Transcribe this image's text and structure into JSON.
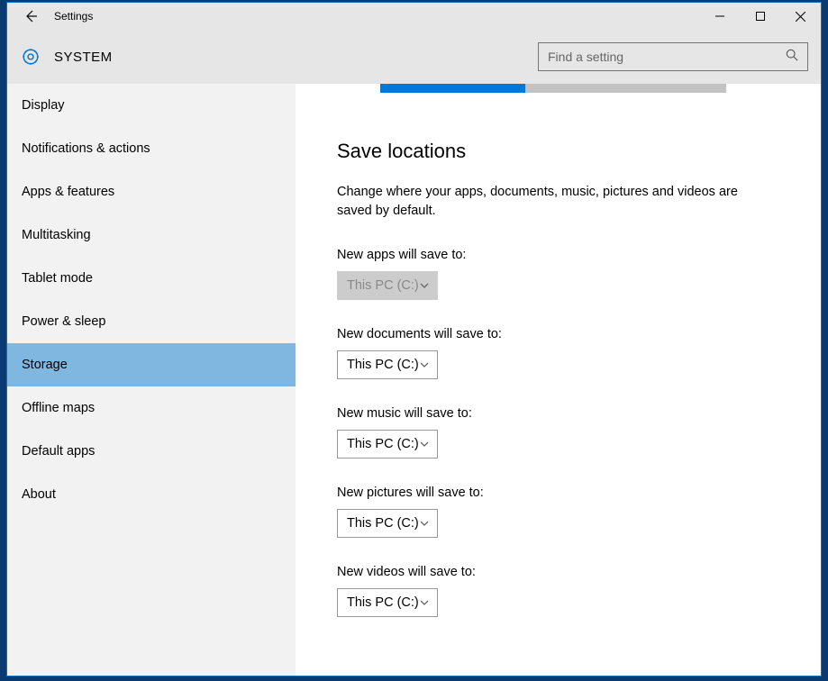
{
  "window": {
    "title": "Settings"
  },
  "header": {
    "category": "SYSTEM",
    "search_placeholder": "Find a setting"
  },
  "sidebar": {
    "items": [
      {
        "label": "Display",
        "selected": false
      },
      {
        "label": "Notifications & actions",
        "selected": false
      },
      {
        "label": "Apps & features",
        "selected": false
      },
      {
        "label": "Multitasking",
        "selected": false
      },
      {
        "label": "Tablet mode",
        "selected": false
      },
      {
        "label": "Power & sleep",
        "selected": false
      },
      {
        "label": "Storage",
        "selected": true
      },
      {
        "label": "Offline maps",
        "selected": false
      },
      {
        "label": "Default apps",
        "selected": false
      },
      {
        "label": "About",
        "selected": false
      }
    ]
  },
  "content": {
    "progress_percent": 42,
    "section_title": "Save locations",
    "section_desc": "Change where your apps, documents, music, pictures and videos are saved by default.",
    "fields": [
      {
        "label": "New apps will save to:",
        "value": "This PC (C:)",
        "disabled": true
      },
      {
        "label": "New documents will save to:",
        "value": "This PC (C:)",
        "disabled": false
      },
      {
        "label": "New music will save to:",
        "value": "This PC (C:)",
        "disabled": false
      },
      {
        "label": "New pictures will save to:",
        "value": "This PC (C:)",
        "disabled": false
      },
      {
        "label": "New videos will save to:",
        "value": "This PC (C:)",
        "disabled": false
      }
    ]
  }
}
